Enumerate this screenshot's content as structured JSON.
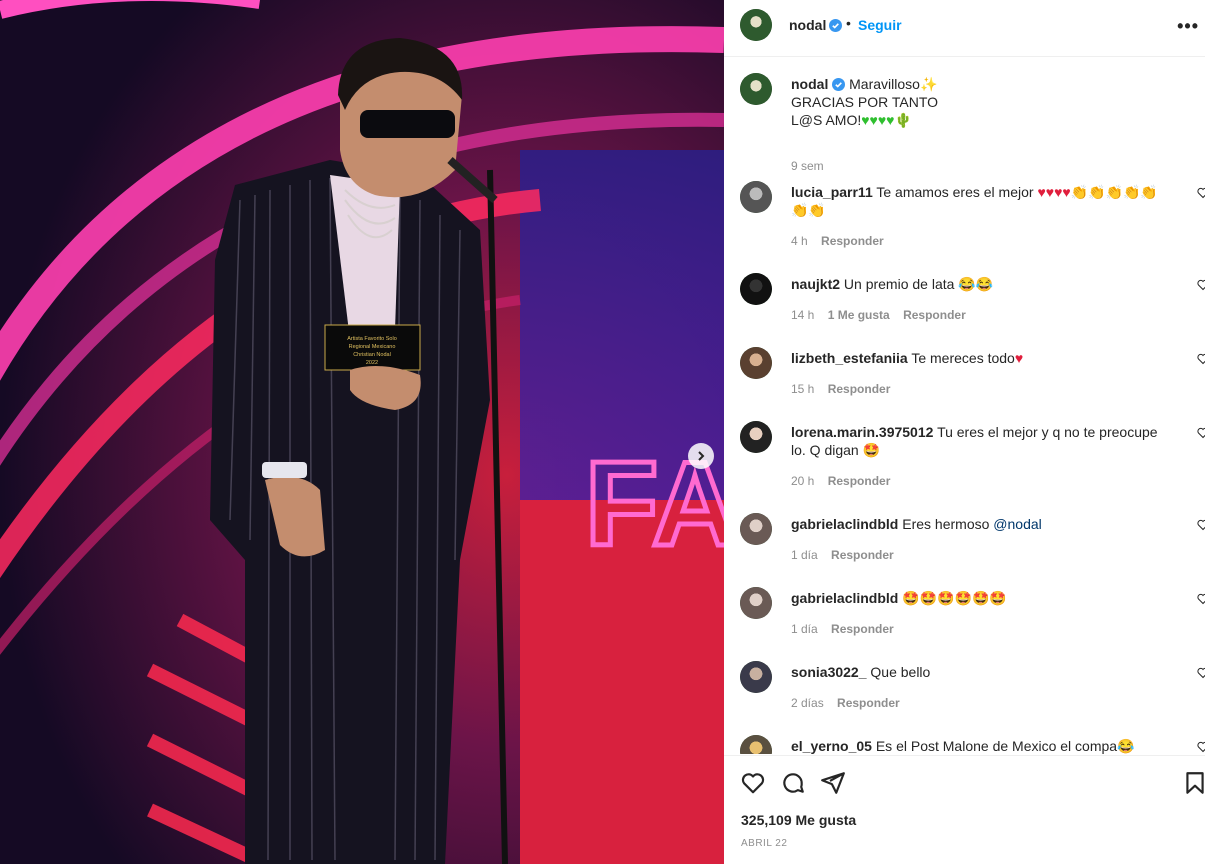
{
  "post": {
    "username": "nodal",
    "follow_label": "Seguir",
    "more_label": "•••",
    "caption": {
      "username": "nodal",
      "line1": "Maravilloso",
      "line2": "GRACIAS POR TANTO",
      "line3": "L@S AMO!",
      "time": "9 sem"
    },
    "likes": "325,109 Me gusta",
    "date": "ABRIL 22"
  },
  "comments": [
    {
      "user": "lucia_parr11",
      "text": "Te amamos eres el mejor",
      "time": "4 h",
      "likes": "",
      "reply": "Responder"
    },
    {
      "user": "naujkt2",
      "text": "Un premio de lata",
      "time": "14 h",
      "likes": "1 Me gusta",
      "reply": "Responder"
    },
    {
      "user": "lizbeth_estefaniia",
      "text": "Te mereces todo",
      "time": "15 h",
      "likes": "",
      "reply": "Responder"
    },
    {
      "user": "lorena.marin.3975012",
      "text": "Tu eres el mejor y q no te preocupe lo. Q digan",
      "time": "20 h",
      "likes": "",
      "reply": "Responder"
    },
    {
      "user": "gabrielaclindbld",
      "text": "Eres hermoso",
      "mention": "@nodal",
      "time": "1 día",
      "likes": "",
      "reply": "Responder"
    },
    {
      "user": "gabrielaclindbld",
      "text": "",
      "time": "1 día",
      "likes": "",
      "reply": "Responder"
    },
    {
      "user": "sonia3022_",
      "text": "Que bello",
      "time": "2 días",
      "likes": "",
      "reply": "Responder"
    },
    {
      "user": "el_yerno_05",
      "text": "Es el Post Malone de Mexico el compa",
      "time": "",
      "likes": "",
      "reply": ""
    }
  ],
  "photo": {
    "sign_text": "FAV",
    "plaque_line1": "Artista Favorito Solo",
    "plaque_line2": "Regional Mexicano",
    "plaque_line3": "Christian Nodal",
    "plaque_line4": "2022"
  },
  "icons": [
    "verified-icon",
    "heart-icon",
    "comment-icon",
    "share-icon",
    "bookmark-icon",
    "chevron-right-icon"
  ],
  "colors": {
    "link": "#0095f6",
    "muted": "#8e8e8e",
    "verified": "#3897f0"
  }
}
